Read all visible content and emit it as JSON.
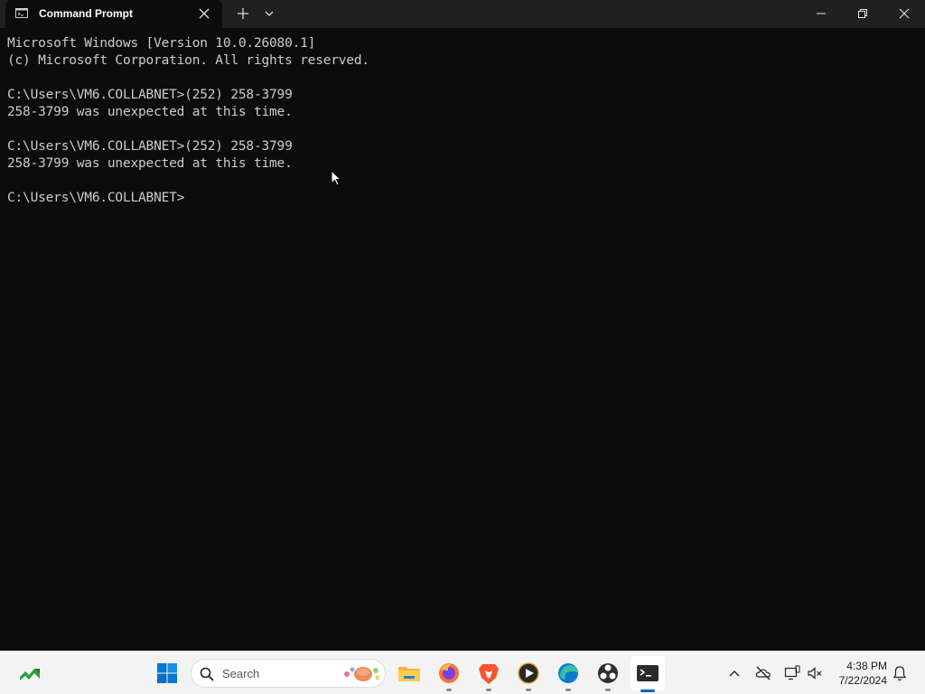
{
  "window": {
    "tab_title": "Command Prompt"
  },
  "terminal": {
    "lines": [
      "Microsoft Windows [Version 10.0.26080.1]",
      "(c) Microsoft Corporation. All rights reserved.",
      "",
      "C:\\Users\\VM6.COLLABNET>(252) 258-3799",
      "258-3799 was unexpected at this time.",
      "",
      "C:\\Users\\VM6.COLLABNET>(252) 258-3799",
      "258-3799 was unexpected at this time.",
      "",
      "C:\\Users\\VM6.COLLABNET>"
    ]
  },
  "taskbar": {
    "search_label": "Search",
    "apps": [
      "start-icon",
      "file-explorer-icon",
      "firefox-icon",
      "brave-icon",
      "media-player-icon",
      "edge-icon",
      "obs-icon",
      "terminal-icon"
    ],
    "tray": {
      "time": "4:38 PM",
      "date": "7/22/2024"
    }
  },
  "colors": {
    "terminal_bg": "#0c0c0c",
    "terminal_fg": "#cccccc",
    "titlebar_bg": "#202020",
    "taskbar_bg": "#f3f3f3",
    "accent": "#0067c0"
  }
}
